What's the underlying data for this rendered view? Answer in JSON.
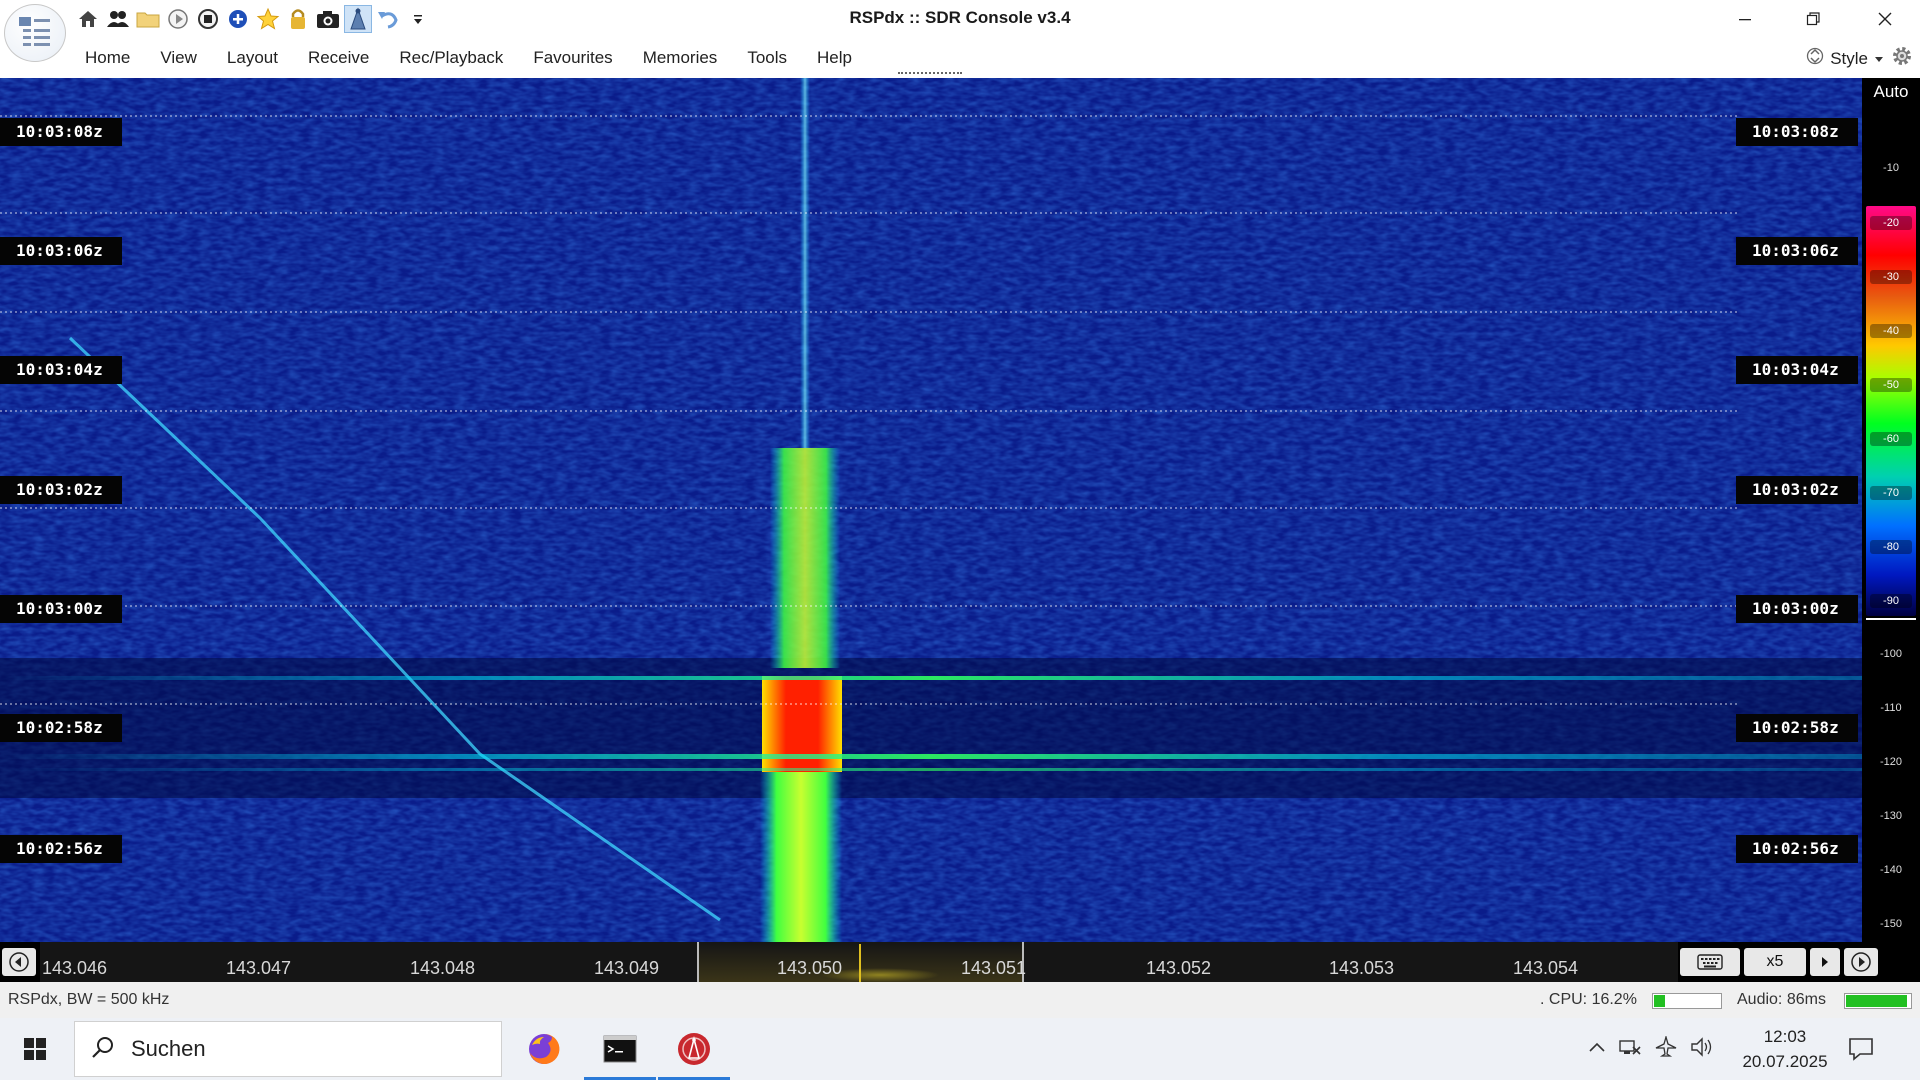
{
  "window": {
    "title": "RSPdx :: SDR Console v3.4"
  },
  "quick_access": [
    {
      "icon": "home-icon"
    },
    {
      "icon": "users-icon"
    },
    {
      "icon": "folder-icon"
    },
    {
      "icon": "play-icon"
    },
    {
      "icon": "stop-icon"
    },
    {
      "icon": "add-icon"
    },
    {
      "icon": "star-icon"
    },
    {
      "icon": "lock-icon"
    },
    {
      "icon": "camera-icon"
    },
    {
      "icon": "antenna-icon"
    },
    {
      "icon": "undo-icon"
    },
    {
      "icon": "customize-dropdown-icon"
    }
  ],
  "menu": [
    "Home",
    "View",
    "Layout",
    "Receive",
    "Rec/Playback",
    "Favourites",
    "Memories",
    "Tools",
    "Help"
  ],
  "style_label": "Style",
  "waterfall": {
    "timestamps": [
      "10:03:08z",
      "10:03:06z",
      "10:03:04z",
      "10:03:02z",
      "10:03:00z",
      "10:02:58z",
      "10:02:56z"
    ],
    "colors": {
      "background": "#0a1c8a",
      "signal_hot": "#ff1a00",
      "signal_mid": "#ffe000",
      "signal_low": "#30ff30",
      "signal_faint": "#00e0ff"
    }
  },
  "level_scale": {
    "mode": "Auto",
    "ticks": [
      "-10",
      "-20",
      "-30",
      "-40",
      "-50",
      "-60",
      "-70",
      "-80",
      "-90",
      "-100",
      "-110",
      "-120",
      "-130",
      "-140",
      "-150"
    ]
  },
  "frequency_axis": {
    "labels": [
      "143.046",
      "143.047",
      "143.048",
      "143.049",
      "143.050",
      "143.051",
      "143.052",
      "143.053",
      "143.054"
    ],
    "zoom": "x5"
  },
  "status": {
    "radio": "RSPdx, BW = 500 kHz",
    "cpu": ". CPU: 16.2%",
    "cpu_value": 0.162,
    "audio": "Audio: 86ms",
    "audio_level": 0.95
  },
  "taskbar": {
    "search_placeholder": "Suchen",
    "apps": [
      {
        "icon": "firefox-icon"
      },
      {
        "icon": "terminal-icon"
      },
      {
        "icon": "sdr-console-icon"
      }
    ],
    "time": "12:03",
    "date": "20.07.2025"
  }
}
